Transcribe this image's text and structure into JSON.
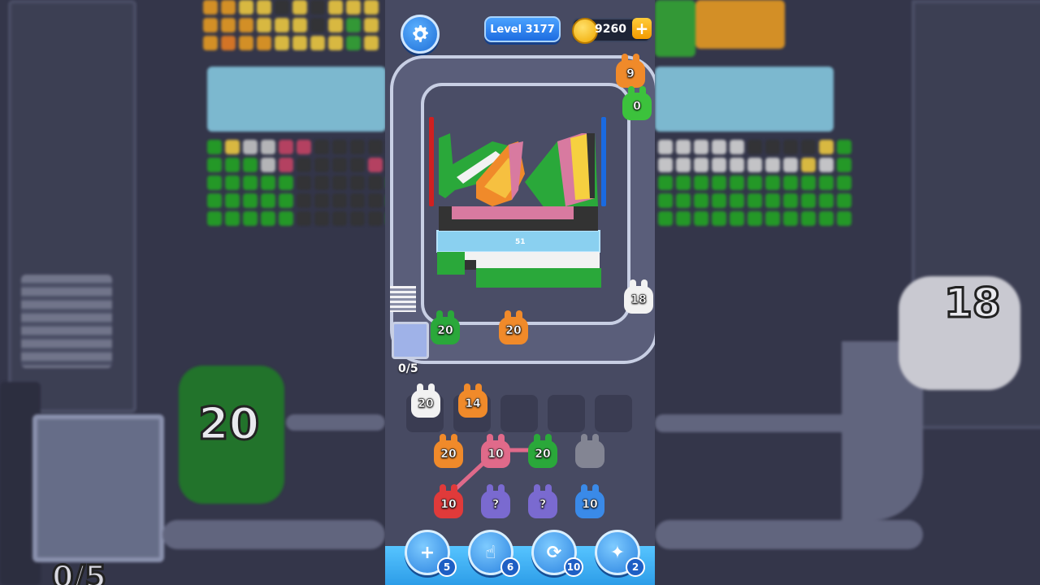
{
  "header": {
    "level_label": "Level 3177",
    "coins": "9260",
    "plus": "+"
  },
  "conveyor": {
    "pieces": [
      {
        "count": "9",
        "color": "#f08a2a"
      },
      {
        "count": "0",
        "color": "#3cc23c"
      },
      {
        "count": "18",
        "color": "#f2f2f2"
      },
      {
        "count": "20",
        "color": "#2aa83a"
      },
      {
        "count": "20",
        "color": "#f08a2a"
      }
    ],
    "pixel_art_label": "51"
  },
  "progress": "0/5",
  "waiting_slots": [
    {
      "count": "20",
      "color": "#f2f2f2"
    },
    {
      "count": "14",
      "color": "#f08a2a"
    },
    {
      "count": "",
      "color": ""
    },
    {
      "count": "",
      "color": ""
    },
    {
      "count": "",
      "color": ""
    }
  ],
  "board": [
    {
      "count": "20",
      "color": "#f08a2a"
    },
    {
      "count": "10",
      "color": "#e06a8a"
    },
    {
      "count": "20",
      "color": "#2aa83a"
    },
    {
      "count": "",
      "color": "#8a8c9a"
    },
    {
      "count": "10",
      "color": "#e03a3a"
    },
    {
      "count": "?",
      "color": "#7a6ad0"
    },
    {
      "count": "?",
      "color": "#7a6ad0"
    },
    {
      "count": "10",
      "color": "#3a8ae8"
    }
  ],
  "boosters": [
    {
      "name": "add-slot",
      "count": "5",
      "glyph": "+"
    },
    {
      "name": "hand",
      "count": "6",
      "glyph": "☝"
    },
    {
      "name": "shuffle",
      "count": "10",
      "glyph": "⟳"
    },
    {
      "name": "magic",
      "count": "2",
      "glyph": "✦"
    }
  ],
  "backdrop": {
    "left_number": "20",
    "left_counter": "0/5",
    "right_number": "18"
  },
  "colors": {
    "accent_blue": "#2d9de8",
    "frame": "#c8cfe4"
  }
}
